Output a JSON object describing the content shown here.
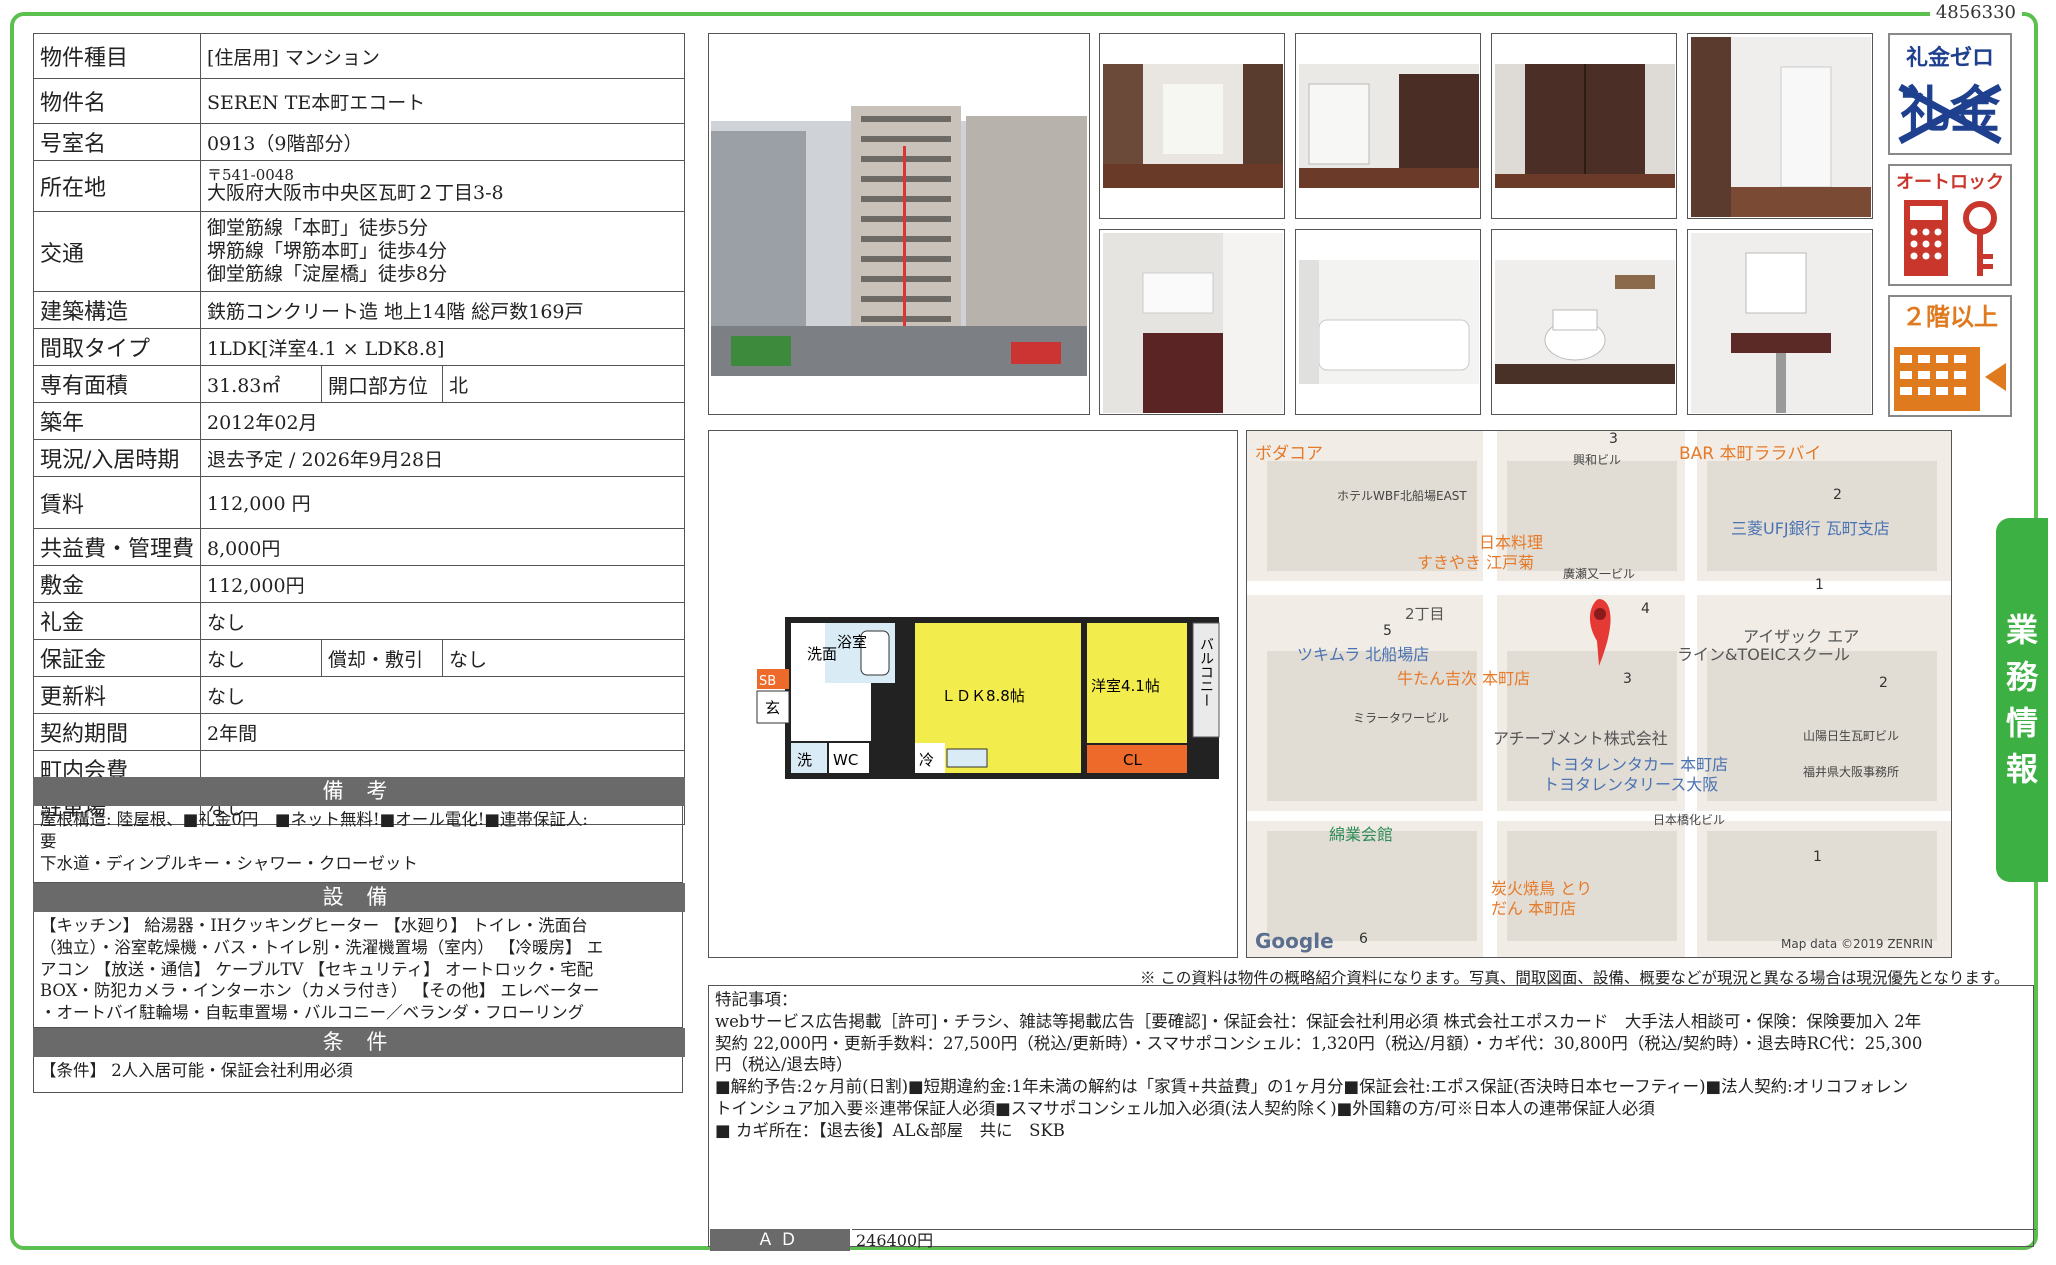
{
  "doc_id": "4856330",
  "info": {
    "type_label": "物件種目",
    "type_value": "[住居用] マンション",
    "name_label": "物件名",
    "name_value": "SEREN TE本町エコート",
    "room_label": "号室名",
    "room_value": "0913（9階部分）",
    "address_label": "所在地",
    "address_zip": "〒541-0048",
    "address_value": "大阪府大阪市中央区瓦町２丁目3-8",
    "transit_label": "交通",
    "transit_lines": [
      "御堂筋線「本町」徒歩5分",
      "堺筋線「堺筋本町」徒歩4分",
      "御堂筋線「淀屋橋」徒歩8分"
    ],
    "structure_label": "建築構造",
    "structure_value": "鉄筋コンクリート造 地上14階 総戸数169戸",
    "layout_label": "間取タイプ",
    "layout_value": "1LDK[洋室4.1 × LDK8.8]",
    "area_label": "専有面積",
    "area_value": "31.83㎡",
    "orientation_label": "開口部方位",
    "orientation_value": "北",
    "built_label": "築年",
    "built_value": "2012年02月",
    "status_label": "現況/入居時期",
    "status_value": "退去予定 /  2026年9月28日",
    "rent_label": "賃料",
    "rent_value": "112,000 円",
    "fee_label": "共益費・管理費",
    "fee_value": "8,000円",
    "deposit_label": "敷金",
    "deposit_value": "112,000円",
    "key_money_label": "礼金",
    "key_money_value": "なし",
    "guarantee_label": "保証金",
    "guarantee_value": "なし",
    "amort_label": "償却・敷引",
    "amort_value": "なし",
    "renewal_label": "更新料",
    "renewal_value": "なし",
    "term_label": "契約期間",
    "term_value": "2年間",
    "assoc_label": "町内会費",
    "assoc_value": "",
    "parking_label": "駐車場",
    "parking_value": "なし"
  },
  "remarks": {
    "title": "備 考",
    "lines": [
      "屋根構造: 陸屋根、■礼金0円　■ネット無料!■オール電化!■連帯保証人:",
      "要",
      "下水道・ディンプルキー・シャワー・クローゼット"
    ]
  },
  "facilities": {
    "title": "設 備",
    "lines": [
      "【キッチン】 給湯器・IHクッキングヒーター 【水廻り】 トイレ・洗面台",
      "（独立）・浴室乾燥機・バス・トイレ別・洗濯機置場（室内） 【冷暖房】 エ",
      "アコン 【放送・通信】 ケーブルTV 【セキュリティ】 オートロック・宅配",
      "BOX・防犯カメラ・インターホン（カメラ付き） 【その他】 エレベーター",
      "・オートバイ駐輪場・自転車置場・バルコニー／ベランダ・フローリング"
    ]
  },
  "conditions": {
    "title": "条 件",
    "lines": [
      "【条件】 2人入居可能・保証会社利用必須"
    ]
  },
  "badges": {
    "zero_key": "礼金ゼロ",
    "zero_key_crossed": "礼金",
    "autolock": "オートロック",
    "second_floor": "２階以上"
  },
  "floorplan": {
    "ldk": "ＬＤＫ8.8帖",
    "western": "洋室4.1帖",
    "bath": "浴室",
    "washroom": "洗面",
    "sb": "SB",
    "entrance": "玄",
    "laundry": "洗",
    "wc": "WC",
    "fridge": "冷",
    "closet": "CL",
    "balcony": "バルコニー"
  },
  "map": {
    "labels": [
      "ボダコア",
      "ホテルWBF北船場EAST",
      "興和ビル",
      "BAR 本町ララバイ",
      "三菱UFJ銀行 瓦町支店",
      "日本料理",
      "すきやき 江戸菊",
      "廣瀬又一ビル",
      "2丁目",
      "ツキムラ 北船場店",
      "牛たん吉次 本町店",
      "ミラータワービル",
      "アチーブメント株式会社",
      "アイザック エア",
      "ライン&TOEICスクール",
      "トヨタレンタカー 本町店",
      "トヨタレンタリース大阪",
      "山陽日生瓦町ビル",
      "福井県大阪事務所",
      "日本橋化ビル",
      "綿業会館",
      "炭火焼鳥 とり",
      "だん 本町店",
      "Google",
      "Map data ©2019 ZENRIN"
    ],
    "numbers": [
      "3",
      "2",
      "1",
      "4",
      "5",
      "3",
      "2",
      "1",
      "6"
    ]
  },
  "disclaimer": "※ この資料は物件の概略紹介資料になります。写真、間取図面、設備、概要などが現況と異なる場合は現況優先となります。",
  "notes": {
    "lines": [
      "特記事項：",
      "webサービス広告掲載［許可]・チラシ、雑誌等掲載広告［要確認]・保証会社：保証会社利用必須 株式会社エポスカード　大手法人相談可・保険：保険要加入 2年",
      "契約 22,000円・更新手数料：27,500円（税込/更新時）・スマサポコンシェル：1,320円（税込/月額）・カギ代：30,800円（税込/契約時）・退去時RC代：25,300",
      "円（税込/退去時）",
      "■解約予告:2ヶ月前(日割)■短期違約金:1年未満の解約は「家賃+共益費」の1ヶ月分■保証会社:エポス保証(否決時日本セーフティー)■法人契約:オリコフォレン",
      "トインシュア加入要※連帯保証人必須■スマサポコンシェル加入必須(法人契約除く)■外国籍の方/可※日本人の連帯保証人必須",
      "■ カギ所在：【退去後】AL&部屋　共に　SKB"
    ]
  },
  "ad": {
    "label": "ＡＤ",
    "value": "246400円"
  },
  "side_tab": [
    "業",
    "務",
    "情",
    "報"
  ],
  "colors": {
    "frame": "#5cc04f",
    "tab": "#3cb043",
    "header_bg": "#6a6a6a",
    "badge_blue": "#1f3f8f",
    "badge_red": "#c9362b",
    "badge_orange": "#e07a1f",
    "plan_yellow": "#f3ec4d",
    "plan_blue": "#d9ecf6",
    "plan_orange": "#ee6a2a"
  }
}
